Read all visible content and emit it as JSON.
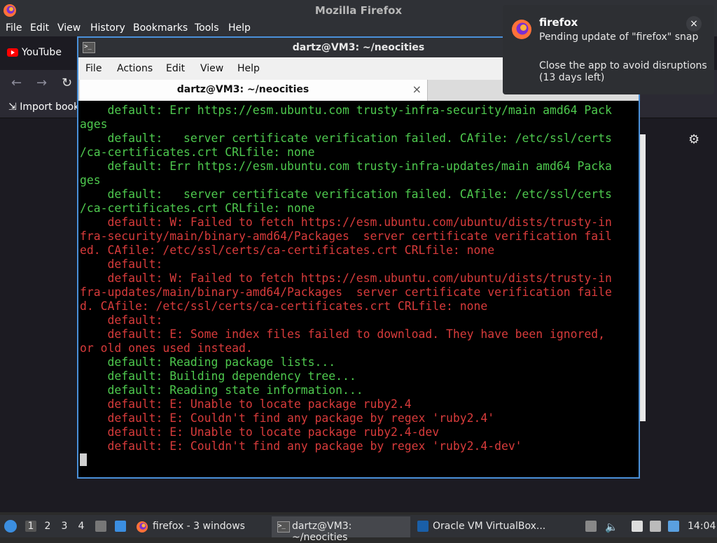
{
  "firefox": {
    "window_title": "Mozilla Firefox",
    "menu": [
      "File",
      "Edit",
      "View",
      "History",
      "Bookmarks",
      "Tools",
      "Help"
    ],
    "tab": {
      "label": "YouTube"
    },
    "bookmarks_item": "Import book"
  },
  "notification": {
    "app": "firefox",
    "line1": "Pending update of \"firefox\" snap",
    "line2": "Close the app to avoid disruptions (13 days left)",
    "close_label": "×"
  },
  "terminal": {
    "title": "dartz@VM3: ~/neocities",
    "menu": [
      "File",
      "Actions",
      "Edit",
      "View",
      "Help"
    ],
    "tab_label": "dartz@VM3: ~/neocities",
    "tab_close": "×",
    "lines": [
      {
        "c": "g",
        "t": "    default: Err https://esm.ubuntu.com trusty-infra-security/main amd64 Pack"
      },
      {
        "c": "g",
        "t": "ages"
      },
      {
        "c": "g",
        "t": "    default:   server certificate verification failed. CAfile: /etc/ssl/certs"
      },
      {
        "c": "g",
        "t": "/ca-certificates.crt CRLfile: none"
      },
      {
        "c": "g",
        "t": "    default: Err https://esm.ubuntu.com trusty-infra-updates/main amd64 Packa"
      },
      {
        "c": "g",
        "t": "ges"
      },
      {
        "c": "g",
        "t": "    default:   server certificate verification failed. CAfile: /etc/ssl/certs"
      },
      {
        "c": "g",
        "t": "/ca-certificates.crt CRLfile: none"
      },
      {
        "c": "r",
        "t": "    default: W: Failed to fetch https://esm.ubuntu.com/ubuntu/dists/trusty-in"
      },
      {
        "c": "r",
        "t": "fra-security/main/binary-amd64/Packages  server certificate verification fail"
      },
      {
        "c": "r",
        "t": "ed. CAfile: /etc/ssl/certs/ca-certificates.crt CRLfile: none"
      },
      {
        "c": "r",
        "t": "    default:"
      },
      {
        "c": "r",
        "t": "    default: W: Failed to fetch https://esm.ubuntu.com/ubuntu/dists/trusty-in"
      },
      {
        "c": "r",
        "t": "fra-updates/main/binary-amd64/Packages  server certificate verification faile"
      },
      {
        "c": "r",
        "t": "d. CAfile: /etc/ssl/certs/ca-certificates.crt CRLfile: none"
      },
      {
        "c": "r",
        "t": "    default:"
      },
      {
        "c": "r",
        "t": "    default: E: Some index files failed to download. They have been ignored,"
      },
      {
        "c": "r",
        "t": "or old ones used instead."
      },
      {
        "c": "g",
        "t": "    default: Reading package lists..."
      },
      {
        "c": "g",
        "t": "    default: Building dependency tree..."
      },
      {
        "c": "g",
        "t": "    default: Reading state information..."
      },
      {
        "c": "r",
        "t": "    default: E: Unable to locate package ruby2.4"
      },
      {
        "c": "r",
        "t": "    default: E: Couldn't find any package by regex 'ruby2.4'"
      },
      {
        "c": "r",
        "t": "    default: E: Unable to locate package ruby2.4-dev"
      },
      {
        "c": "r",
        "t": "    default: E: Couldn't find any package by regex 'ruby2.4-dev'"
      }
    ]
  },
  "taskbar": {
    "workspaces": [
      "1",
      "2",
      "3",
      "4"
    ],
    "active_workspace": "1",
    "tasks": {
      "firefox": "firefox - 3 windows",
      "terminal": "dartz@VM3: ~/neocities",
      "vbox": "Oracle VM VirtualBox..."
    },
    "clock": "14:04"
  },
  "icons": {
    "firefox": "firefox-icon",
    "terminal": "terminal-icon",
    "settings": "gear-icon",
    "volume": "speaker-icon",
    "start": "start-menu-icon"
  },
  "colors": {
    "terminal_green": "#4ec94e",
    "terminal_red": "#d83b3b",
    "focus_border": "#4a90d9",
    "panel": "#2f3136"
  }
}
